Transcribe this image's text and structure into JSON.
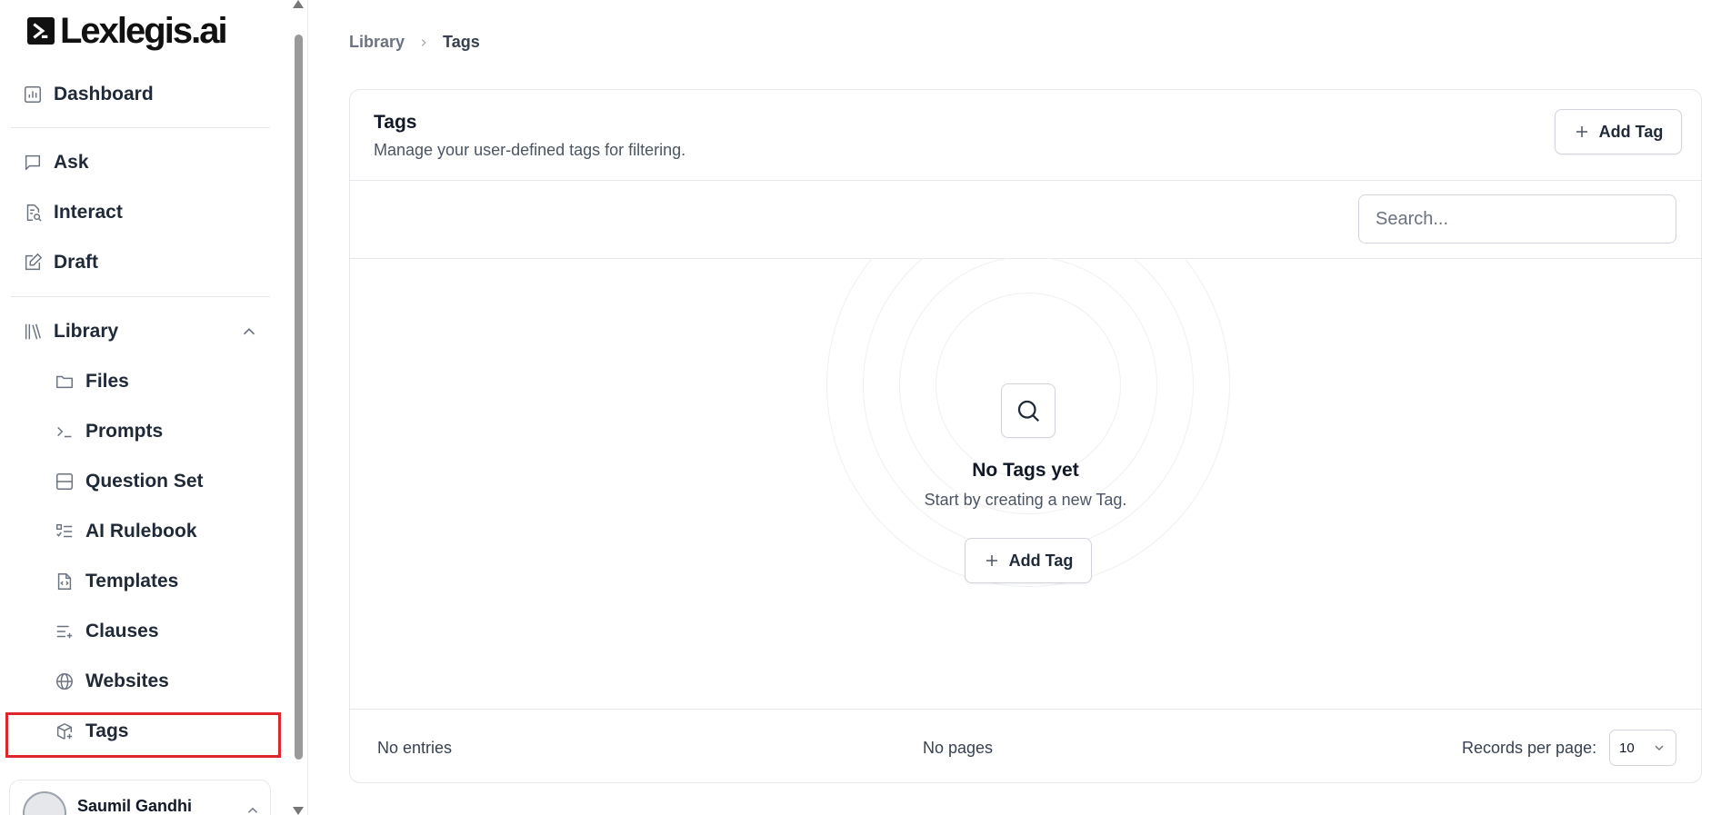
{
  "brand": {
    "name": "Lexlegis.ai"
  },
  "sidebar": {
    "items": [
      {
        "label": "Dashboard",
        "icon": "bar-chart-icon"
      },
      {
        "label": "Ask",
        "icon": "message-square-icon"
      },
      {
        "label": "Interact",
        "icon": "file-search-icon"
      },
      {
        "label": "Draft",
        "icon": "edit-icon"
      },
      {
        "label": "Library",
        "icon": "library-icon",
        "expanded": true
      }
    ],
    "library_items": [
      {
        "label": "Files",
        "icon": "folder-icon"
      },
      {
        "label": "Prompts",
        "icon": "terminal-icon"
      },
      {
        "label": "Question Set",
        "icon": "panel-icon"
      },
      {
        "label": "AI Rulebook",
        "icon": "list-checks-icon"
      },
      {
        "label": "Templates",
        "icon": "file-code-icon"
      },
      {
        "label": "Clauses",
        "icon": "list-plus-icon"
      },
      {
        "label": "Websites",
        "icon": "globe-icon"
      },
      {
        "label": "Tags",
        "icon": "package-plus-icon",
        "active": true
      }
    ],
    "user": {
      "name": "Saumil Gandhi"
    }
  },
  "breadcrumb": {
    "parent": "Library",
    "current": "Tags"
  },
  "card": {
    "title": "Tags",
    "subtitle": "Manage your user-defined tags for filtering.",
    "add_label": "Add Tag",
    "search_placeholder": "Search...",
    "empty": {
      "title": "No Tags yet",
      "subtitle": "Start by creating a new Tag.",
      "add_label": "Add Tag"
    },
    "footer": {
      "entries": "No entries",
      "pages": "No pages",
      "per_page_label": "Records per page:",
      "per_page_value": "10"
    }
  },
  "colors": {
    "highlight": "#e0262d",
    "border": "#e5e7eb",
    "text": "#1f2937"
  }
}
